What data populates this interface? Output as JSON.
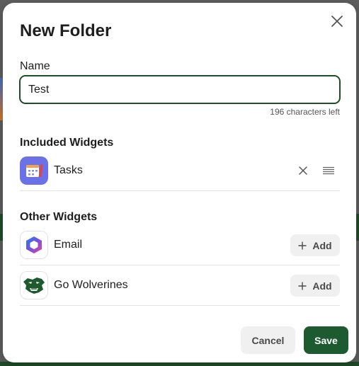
{
  "dialog": {
    "title": "New Folder",
    "close_icon": "close-icon"
  },
  "name_field": {
    "label": "Name",
    "value": "Test",
    "chars_left": "196 characters left"
  },
  "included_widgets": {
    "title": "Included Widgets",
    "items": [
      {
        "name": "Tasks",
        "icon": "tasks-app-icon"
      }
    ]
  },
  "other_widgets": {
    "title": "Other Widgets",
    "items": [
      {
        "name": "Email",
        "icon": "email-app-icon",
        "add_label": "Add"
      },
      {
        "name": "Go Wolverines",
        "icon": "wolverine-logo-icon",
        "add_label": "Add"
      }
    ]
  },
  "footer": {
    "cancel_label": "Cancel",
    "save_label": "Save"
  },
  "colors": {
    "accent": "#1e5a30",
    "input_border": "#1e4d2b",
    "secondary_button": "#f0f0f0"
  }
}
